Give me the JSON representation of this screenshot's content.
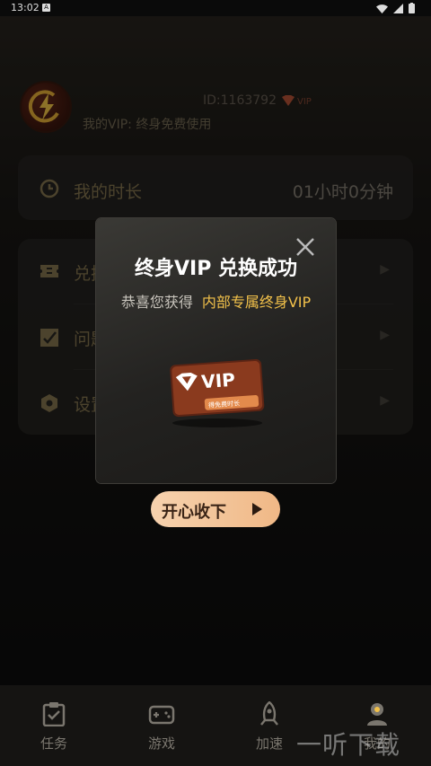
{
  "status_bar": {
    "time": "13:02",
    "notif_glyph": "A"
  },
  "profile": {
    "id_text": "ID:1163792",
    "vip_badge": "VIP",
    "vip_status": "我的VIP: 终身免费使用"
  },
  "duration_card": {
    "label": "我的时长",
    "value": "01小时0分钟"
  },
  "menu": {
    "items": [
      {
        "label": "兑换",
        "icon": "ticket-icon"
      },
      {
        "label": "问题",
        "icon": "feedback-icon"
      },
      {
        "label": "设置",
        "icon": "settings-icon"
      }
    ]
  },
  "modal": {
    "title": "终身VIP 兑换成功",
    "subtitle_prefix": "恭喜您获得",
    "subtitle_highlight": "内部专属终身VIP",
    "card_label": "VIP",
    "card_tag": "得免费时长",
    "accept_label": "开心收下"
  },
  "tabbar": {
    "tabs": [
      {
        "label": "任务",
        "icon": "clipboard-check-icon"
      },
      {
        "label": "游戏",
        "icon": "gamepad-icon"
      },
      {
        "label": "加速",
        "icon": "rocket-icon"
      },
      {
        "label": "我的",
        "icon": "user-icon"
      }
    ]
  },
  "watermark": "一听下载",
  "colors": {
    "accent_gold": "#f2c14a",
    "button_peach": "#f6d2ae",
    "background": "#0c0c0c"
  }
}
